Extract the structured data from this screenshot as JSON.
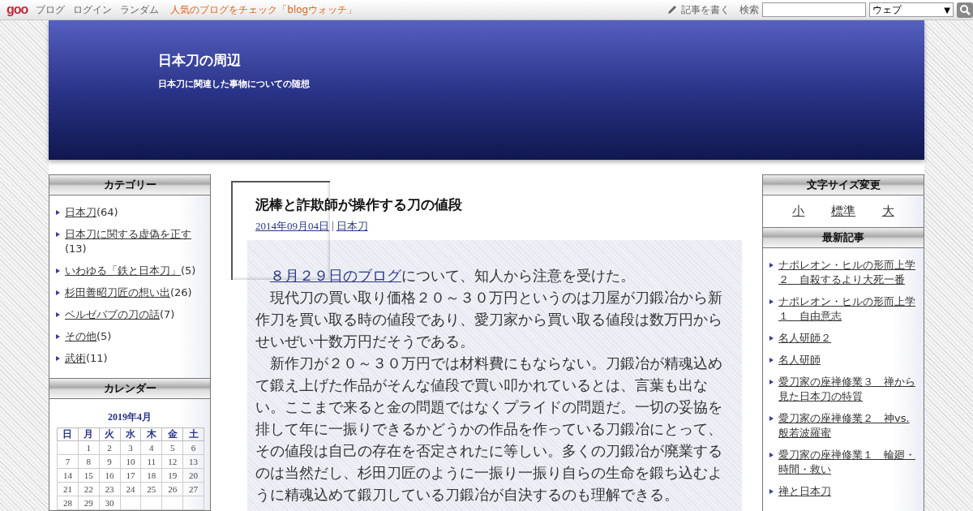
{
  "top_bar": {
    "logo": "goo",
    "links": [
      "ブログ",
      "ログイン",
      "ランダム"
    ],
    "promo": "人気のブログをチェック「blogウォッチ」",
    "write": "記事を書く",
    "search_label": "検索",
    "search_scope": "ウェブ",
    "scope_caret": "▼"
  },
  "header": {
    "title": "日本刀の周辺",
    "subtitle": "日本刀に関連した事物についての随想"
  },
  "categories": {
    "title": "カテゴリー",
    "items": [
      {
        "name": "日本刀",
        "count": "(64)"
      },
      {
        "name": "日本刀に関する虚偽を正す",
        "count": "(13)"
      },
      {
        "name": "いわゆる「鉄と日本刀」",
        "count": "(5)"
      },
      {
        "name": "杉田善昭刀匠の想い出",
        "count": "(26)"
      },
      {
        "name": "ベルゼバブの刀の話",
        "count": "(7)"
      },
      {
        "name": "その他",
        "count": "(5)"
      },
      {
        "name": "武術",
        "count": "(11)"
      }
    ]
  },
  "calendar": {
    "title": "カレンダー",
    "month": "2019年4月",
    "weekdays": [
      "日",
      "月",
      "火",
      "水",
      "木",
      "金",
      "土"
    ],
    "weeks": [
      [
        "1",
        "2",
        "3",
        "4",
        "5",
        "6"
      ],
      [
        "7",
        "8",
        "9",
        "10",
        "11",
        "12",
        "13"
      ],
      [
        "14",
        "15",
        "16",
        "17",
        "18",
        "19",
        "20"
      ],
      [
        "21",
        "22",
        "23",
        "24",
        "25",
        "26",
        "27"
      ],
      [
        "28",
        "29",
        "30"
      ]
    ]
  },
  "post": {
    "title": "泥棒と詐欺師が操作する刀の値段",
    "date": "2014年09月04日",
    "separator": "|",
    "category": "日本刀",
    "paragraphs": [
      {
        "link": "８月２９日のブログ",
        "text": "について、知人から注意を受けた。"
      },
      {
        "text": "現代刀の買い取り価格２０～３０万円というのは刀屋が刀鍛冶から新作刀を買い取る時の値段であり、愛刀家から買い取る値段は数万円からせいぜい十数万円だそうである。"
      },
      {
        "text": "新作刀が２０～３０万円では材料費にもならない。刀鍛冶が精魂込めて鍛え上げた作品がそんな値段で買い叩かれているとは、言葉も出ない。ここまで来ると金の問題ではなくプライドの問題だ。一切の妥協を排して年に一振りできるかどうかの作品を作っている刀鍛冶にとって、その値段は自己の存在を否定されたに等しい。多くの刀鍛冶が廃業するのは当然だし、杉田刀匠のように一振り一振り自らの生命を鍛ち込むように精魂込めて鍛刀している刀鍛冶が自決するのも理解できる。"
      }
    ]
  },
  "font_size": {
    "title": "文字サイズ変更",
    "options": [
      "小",
      "標準",
      "大"
    ]
  },
  "recent": {
    "title": "最新記事",
    "items": [
      "ナポレオン・ヒルの形而上学２　自殺するより大死一番",
      "ナポレオン・ヒルの形而上学１　自由意志",
      "名人研師２",
      "名人研師",
      "愛刀家の座禅修業３　禅から見た日本刀の特質",
      "愛刀家の座禅修業２　神vs.般若波羅蜜",
      "愛刀家の座禅修業１　輪廻・時間・救い",
      "禅と日本刀"
    ]
  }
}
